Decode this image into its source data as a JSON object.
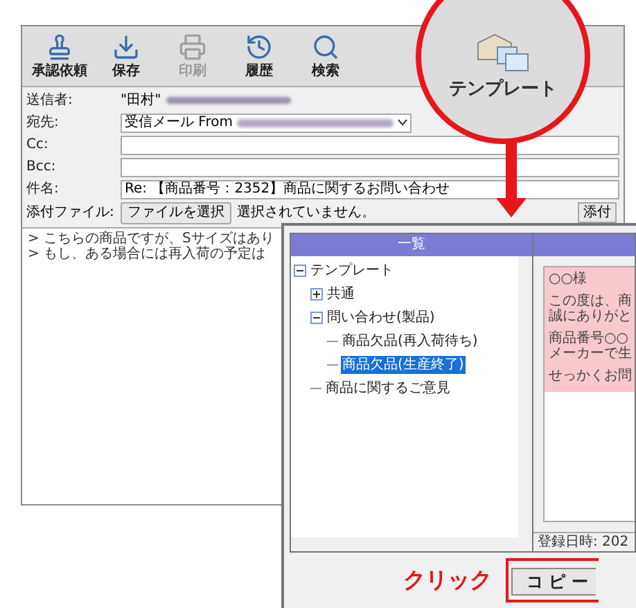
{
  "toolbar": {
    "buttons": [
      {
        "label": "承認依頼",
        "disabled": false,
        "kind": "stamp"
      },
      {
        "label": "保存",
        "disabled": false,
        "kind": "save"
      },
      {
        "label": "印刷",
        "disabled": true,
        "kind": "print"
      },
      {
        "label": "履歴",
        "disabled": false,
        "kind": "history"
      },
      {
        "label": "検索",
        "disabled": false,
        "kind": "search"
      }
    ]
  },
  "template_button": {
    "label": "テンプレート"
  },
  "fields": [
    {
      "label": "送信者:",
      "value": "\"田村\"",
      "kind": "text",
      "redacted": true
    },
    {
      "label": "宛先:",
      "value": "受信メール From",
      "kind": "select",
      "redacted": true
    },
    {
      "label": "Cc:",
      "kind": "input"
    },
    {
      "label": "Bcc:",
      "kind": "input"
    },
    {
      "label": "件名:",
      "value": "Re: 【商品番号：2352】商品に関するお問い合わせ",
      "kind": "input"
    }
  ],
  "attachment": {
    "label": "添付ファイル:",
    "button": "ファイルを選択",
    "status": "選択されていません。",
    "attach_button": "添付"
  },
  "body_lines": [
    "> こちらの商品ですが、Sサイズはあり",
    "> もし、ある場合には再入荷の予定は"
  ],
  "dialog": {
    "header": "一覧",
    "tree": [
      {
        "label": "テンプレート",
        "expanded": true,
        "selected": false,
        "children": [
          {
            "label": "共通",
            "expanded": false,
            "selected": false
          },
          {
            "label": "問い合わせ(製品)",
            "expanded": true,
            "selected": false,
            "children": [
              {
                "label": "商品欠品(再入荷待ち)",
                "selected": false
              },
              {
                "label": "商品欠品(生産終了)",
                "selected": true
              }
            ]
          },
          {
            "label": "商品に関するご意見",
            "selected": false
          }
        ]
      }
    ],
    "preview_paragraphs": [
      [
        "○○様"
      ],
      [
        "この度は、商",
        "誠にありがと"
      ],
      [
        "商品番号○○",
        "メーカーで生"
      ],
      [
        "せっかくお問"
      ]
    ],
    "registered": "登録日時: 202",
    "copy_button": "コ ピ ー"
  },
  "annotation": "クリック"
}
